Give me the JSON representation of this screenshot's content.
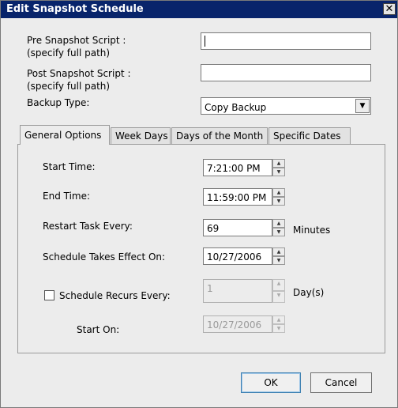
{
  "window": {
    "title": "Edit Snapshot Schedule",
    "close_symbol": "✕"
  },
  "form": {
    "pre_script_label_1": "Pre Snapshot Script :",
    "pre_script_label_2": "(specify full path)",
    "pre_script_value": "",
    "post_script_label_1": "Post Snapshot Script :",
    "post_script_label_2": "(specify full path)",
    "post_script_value": "",
    "backup_type_label": "Backup Type:",
    "backup_type_value": "Copy Backup"
  },
  "tabs": [
    {
      "label": "General Options",
      "active": true
    },
    {
      "label": "Week Days",
      "active": false
    },
    {
      "label": "Days of the Month",
      "active": false
    },
    {
      "label": "Specific Dates",
      "active": false
    }
  ],
  "general": {
    "start_time_label": "Start Time:",
    "start_time_value": "7:21:00 PM",
    "end_time_label": "End Time:",
    "end_time_value": "11:59:00 PM",
    "restart_label": "Restart Task Every:",
    "restart_value": "69",
    "restart_unit": "Minutes",
    "effect_label": "Schedule Takes Effect On:",
    "effect_value": "10/27/2006",
    "recurs_label": "Schedule Recurs Every:",
    "recurs_checked": false,
    "recurs_value": "1",
    "recurs_unit": "Day(s)",
    "start_on_label": "Start On:",
    "start_on_value": "10/27/2006"
  },
  "buttons": {
    "ok": "OK",
    "cancel": "Cancel"
  },
  "colors": {
    "titlebar": "#08246b",
    "window_bg": "#ececec"
  }
}
